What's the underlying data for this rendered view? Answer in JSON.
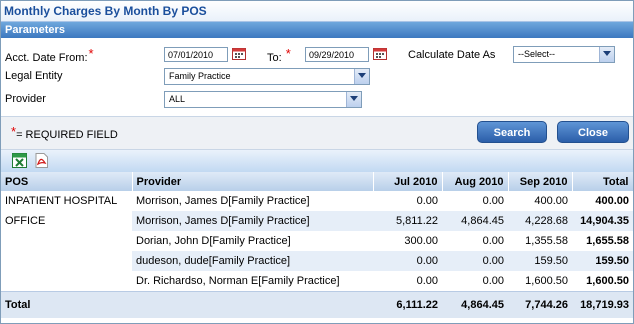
{
  "title": "Monthly Charges By Month By POS",
  "parameters": {
    "header": "Parameters",
    "acct_date_from_label": "Acct. Date From:",
    "acct_date_from_value": "07/01/2010",
    "to_label": "To:",
    "to_value": "09/29/2010",
    "calculate_date_as_label": "Calculate Date As",
    "calculate_date_as_value": "--Select--",
    "legal_entity_label": "Legal Entity",
    "legal_entity_value": "Family Practice",
    "provider_label": "Provider",
    "provider_value": "ALL",
    "required_marker": "*",
    "required_note": "= REQUIRED FIELD",
    "search_label": "Search",
    "close_label": "Close"
  },
  "toolbar": {
    "icons": [
      "excel-export-icon",
      "pdf-export-icon"
    ]
  },
  "table": {
    "columns": [
      "POS",
      "Provider",
      "Jul 2010",
      "Aug 2010",
      "Sep 2010",
      "Total"
    ],
    "rows": [
      {
        "pos": "INPATIENT HOSPITAL",
        "provider": "Morrison, James D[Family Practice]",
        "jul": "0.00",
        "aug": "0.00",
        "sep": "400.00",
        "total": "400.00"
      },
      {
        "pos": "OFFICE",
        "provider": "Morrison, James D[Family Practice]",
        "jul": "5,811.22",
        "aug": "4,864.45",
        "sep": "4,228.68",
        "total": "14,904.35"
      },
      {
        "pos": "",
        "provider": "Dorian, John D[Family Practice]",
        "jul": "300.00",
        "aug": "0.00",
        "sep": "1,355.58",
        "total": "1,655.58"
      },
      {
        "pos": "",
        "provider": "dudeson, dude[Family Practice]",
        "jul": "0.00",
        "aug": "0.00",
        "sep": "159.50",
        "total": "159.50"
      },
      {
        "pos": "",
        "provider": "Dr. Richardso, Norman E[Family Practice]",
        "jul": "0.00",
        "aug": "0.00",
        "sep": "1,600.50",
        "total": "1,600.50"
      }
    ],
    "total": {
      "label": "Total",
      "jul": "6,111.22",
      "aug": "4,864.45",
      "sep": "7,744.26",
      "total": "18,719.93"
    }
  }
}
